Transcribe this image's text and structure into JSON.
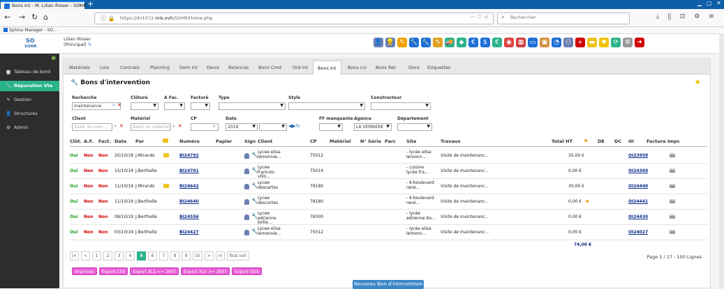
{
  "browser": {
    "tab_title": "Bons Int - M. Lilian Risser - SOHR",
    "new_tab": "+",
    "url_prefix": "https://dn1072.",
    "url_domain": "mis.ovh",
    "url_suffix": "/SOHR/Home.php",
    "url_right_icons": "··· ♡ ☆",
    "search_placeholder": "Rechercher",
    "toolbar_icons": "⤓ ⫼ ⊡ ⚙ ≡",
    "bookmark": "Sphinx Manager - SO..."
  },
  "header": {
    "logo_line1": "SO",
    "logo_line2": "SOHR",
    "user_name": "Lilian Risser",
    "user_role": "(Principal)",
    "icons": [
      {
        "name": "person-icon",
        "color": "#6b7fb3",
        "glyph": "👤"
      },
      {
        "name": "worker-icon",
        "color": "#6b7fb3",
        "glyph": "👷"
      },
      {
        "name": "pencil-icon",
        "color": "#f0a000",
        "glyph": "✎"
      },
      {
        "name": "tools-icon",
        "color": "#1d6fd6",
        "glyph": "🔧"
      },
      {
        "name": "wrench-icon",
        "color": "#1d6fd6",
        "glyph": "🔧"
      },
      {
        "name": "edit-icon",
        "color": "#e0a020",
        "glyph": "✎"
      },
      {
        "name": "truck-icon",
        "color": "#2bb38b",
        "glyph": "🚚"
      },
      {
        "name": "cube-icon",
        "color": "#2bb38b",
        "glyph": "◆"
      },
      {
        "name": "euro-icon",
        "color": "#1d6fd6",
        "glyph": "€"
      },
      {
        "name": "money-icon",
        "color": "#1d6fd6",
        "glyph": "$"
      },
      {
        "name": "euro-green-icon",
        "color": "#2bb38b",
        "glyph": "€"
      },
      {
        "name": "cd-icon",
        "color": "#e04040",
        "glyph": "◉"
      },
      {
        "name": "calendar-icon",
        "color": "#d23b3b",
        "glyph": "▦"
      },
      {
        "name": "screen-icon",
        "color": "#1d6fd6",
        "glyph": "▭"
      },
      {
        "name": "box-icon",
        "color": "#d09040",
        "glyph": "▣"
      },
      {
        "name": "chart-icon",
        "color": "#1d6fd6",
        "glyph": "◔"
      },
      {
        "name": "org-icon",
        "color": "#6b7fb3",
        "glyph": "⚇"
      },
      {
        "name": "medical-icon",
        "color": "#d00000",
        "glyph": "+"
      },
      {
        "name": "folder-icon",
        "color": "#f0c21b",
        "glyph": "▬"
      },
      {
        "name": "bulb-icon",
        "color": "#f2c200",
        "glyph": "✺"
      },
      {
        "name": "refresh-icon",
        "color": "#2bb38b",
        "glyph": "⟳"
      },
      {
        "name": "gear-icon",
        "color": "#999999",
        "glyph": "⚙"
      },
      {
        "name": "logout-icon",
        "color": "#d00000",
        "glyph": "➜"
      }
    ]
  },
  "sidebar": {
    "items": [
      {
        "label": "Tableau de bord",
        "icon": "▆",
        "name": "sidebar-item-dashboard",
        "active": false
      },
      {
        "label": "Réparation Vte",
        "icon": "🔧",
        "name": "sidebar-item-reparation",
        "active": true
      },
      {
        "label": "Gestion",
        "icon": "✎",
        "name": "sidebar-item-gestion",
        "active": false
      },
      {
        "label": "Structures",
        "icon": "👤",
        "name": "sidebar-item-structures",
        "active": false
      },
      {
        "label": "Admin",
        "icon": "⚙",
        "name": "sidebar-item-admin",
        "active": false
      }
    ]
  },
  "tabs": [
    "Matériels",
    "Lots",
    "Contrats",
    "Planning",
    "Dem Int",
    "Devis",
    "Relances",
    "Bons Cmd",
    "Ord Int",
    "Bons Int",
    "Bons Liv",
    "Bons Ret",
    "Docs",
    "Etiquettes"
  ],
  "active_tab": "Bons Int",
  "page_title": "Bons d'intervention",
  "filters": {
    "recherche_label": "Recherche",
    "recherche_value": "maintenance",
    "cloture_label": "Clôturé",
    "afac_label": "A Fac.",
    "facture_label": "Facturé",
    "type_label": "Type",
    "style_label": "Style",
    "constructeur_label": "Constructeur",
    "client_label": "Client",
    "client_placeholder": "Saisir un nom ...",
    "materiel_label": "Matériel",
    "materiel_placeholder": "Saisir un matériel",
    "cp_label": "CP",
    "date_label": "Date",
    "date_value": "2019",
    "ff_label": "FF manquante",
    "agence_label": "Agence",
    "agence_value": "LA VERRIERE",
    "departement_label": "Département"
  },
  "columns": [
    "Clôt.",
    "A.F.",
    "Fact.",
    "Date",
    "Par",
    "",
    "Numéro",
    "Papier",
    "Sign",
    "Client",
    "CP",
    "Matériel",
    "N° Série",
    "Parc",
    "Site",
    "Travaux",
    "Total HT",
    "",
    "DE",
    "DC",
    "OI",
    "Facture",
    "Impr."
  ],
  "rows": [
    {
      "clot": "Oui",
      "af": "Non",
      "fact": "Non",
      "date": "20/10/18",
      "par": "J.Mirands",
      "folder": true,
      "numero": "BI24792",
      "client": "Lycee elisa lemonnie...",
      "cp": "75012",
      "site": "- lycée elisa lemonn...",
      "travaux": "Visite de maintenanc...",
      "total": "35,00 €",
      "flag": false,
      "oi": "OI23958"
    },
    {
      "clot": "Oui",
      "af": "Non",
      "fact": "Non",
      "date": "15/10/19",
      "par": "J.Berthelle",
      "folder": false,
      "numero": "BI24701",
      "client": "Lycee francois villo...",
      "cp": "75014",
      "site": "- cuisine lycée fra...",
      "travaux": "Visite de maintenanc...",
      "total": "0,00 €",
      "flag": false,
      "oi": "OI24369"
    },
    {
      "clot": "Oui",
      "af": "Non",
      "fact": "Non",
      "date": "11/10/19",
      "par": "J.Mirands",
      "folder": true,
      "numero": "BI24642",
      "client": "Lycee descartes",
      "cp": "78180",
      "site": "- 6 boulevard rené...",
      "travaux": "Visite de maintenanc...",
      "total": "30,00 €",
      "flag": false,
      "oi": "OI24440"
    },
    {
      "clot": "Oui",
      "af": "Non",
      "fact": "Non",
      "date": "11/10/19",
      "par": "J.Berthelle",
      "folder": false,
      "numero": "BI24640",
      "client": "Lycee descartes",
      "cp": "78180",
      "site": "- 6 boulevard rené...",
      "travaux": "Visite de maintenanc...",
      "total": "0,00 €",
      "flag": true,
      "oi": "OI24441"
    },
    {
      "clot": "Oui",
      "af": "Non",
      "fact": "Non",
      "date": "08/10/19",
      "par": "J.Berthelle",
      "folder": false,
      "numero": "BI24556",
      "client": "Lycee adrienne bolla...",
      "cp": "78300",
      "site": "- lycée adrienne bo...",
      "travaux": "Visite de maintenanc...",
      "total": "0,00 €",
      "flag": false,
      "oi": "OI24430"
    },
    {
      "clot": "Oui",
      "af": "Non",
      "fact": "Non",
      "date": "03/10/19",
      "par": "J.Berthelle",
      "folder": false,
      "numero": "BI24427",
      "client": "Lycee elisa lemonnie...",
      "cp": "75012",
      "site": "- lycée elisa lemonn...",
      "travaux": "Visite de maintenanc...",
      "total": "0,00 €",
      "flag": false,
      "oi": "OI24027"
    }
  ],
  "total_sum": "74,00 €",
  "pager": {
    "items": [
      "|<",
      "<",
      "1",
      "2",
      "3",
      "4",
      "5",
      "6",
      "7",
      "8",
      "9",
      "10",
      ">",
      ">|",
      "Tout voir"
    ],
    "active": "5",
    "info": "Page 5 / 17 - 100 Lignes"
  },
  "exports": [
    "Imprimer",
    "Export CSV",
    "Export XLS <= 2007",
    "Export XLS >= 2007",
    "Export ODS"
  ],
  "new_button": "Nouveau Bon d'intervention"
}
